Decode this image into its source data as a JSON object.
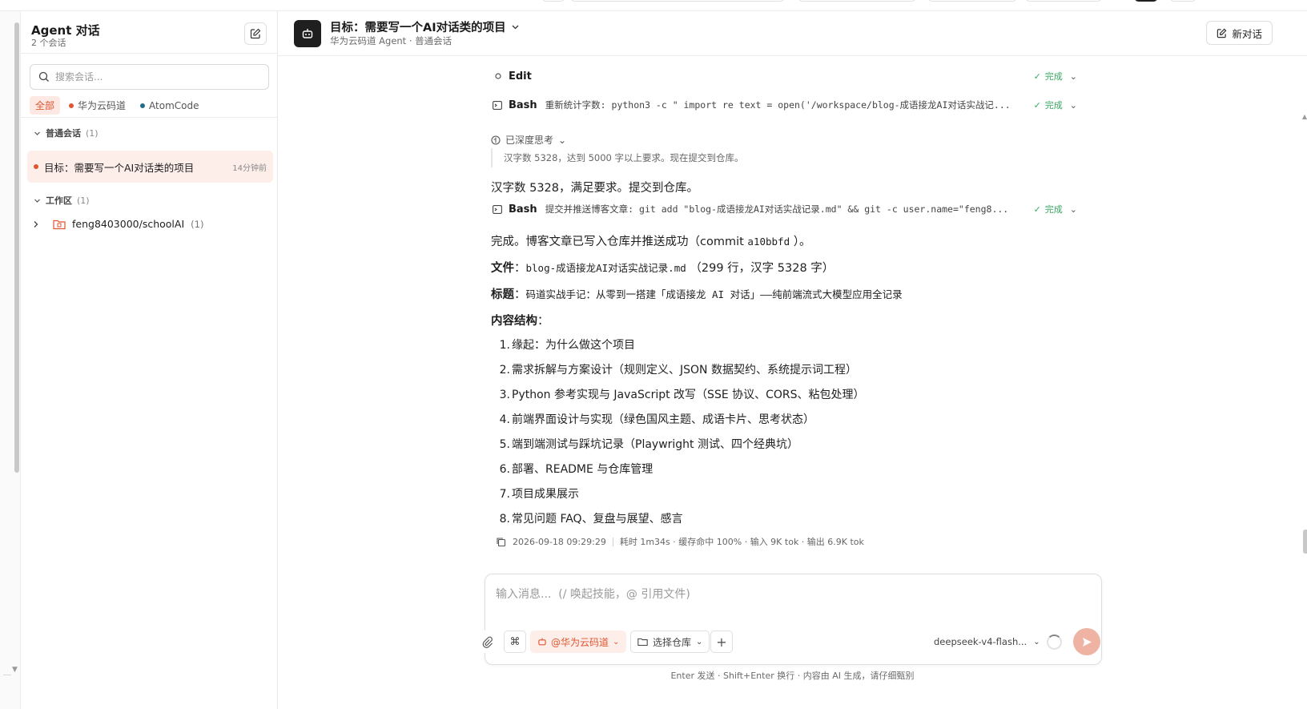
{
  "sidebar": {
    "title": "Agent 对话",
    "subtitle": "2 个会话",
    "search_placeholder": "搜索会话...",
    "filters": [
      {
        "label": "全部",
        "active": true
      },
      {
        "label": "华为云码道",
        "dot_color": "#e0552f"
      },
      {
        "label": "AtomCode",
        "dot_color": "#1f6f8b"
      }
    ],
    "groups": {
      "normal": {
        "label": "普通会话",
        "count": "(1)"
      },
      "workspace": {
        "label": "工作区",
        "count": "(1)"
      }
    },
    "conversation": {
      "label": "目标：需要写一个AI对话类的项目",
      "time": "14分钟前"
    },
    "workspace_item": {
      "label": "feng8403000/schoolAI",
      "count": "(1)"
    }
  },
  "header": {
    "title": "目标：需要写一个AI对话类的项目",
    "subtitle": "华为云码道 Agent · 普通会话",
    "new_chat_label": "新对话"
  },
  "chat": {
    "tools": [
      {
        "name": "Edit",
        "cmd": "",
        "status": "完成"
      },
      {
        "name": "Bash",
        "cmd": "重新统计字数: python3 -c \" import re text = open('/workspace/blog-成语接龙AI对话实战记...",
        "status": "完成"
      },
      {
        "name": "Bash",
        "cmd": "提交并推送博客文章: git add \"blog-成语接龙AI对话实战记录.md\" && git -c user.name=\"feng8...",
        "status": "完成"
      }
    ],
    "thinking_label": "已深度思考",
    "thinking_text": "汉字数 5328，达到 5000 字以上要求。现在提交到仓库。",
    "msg1": "汉字数 5328，满足要求。提交到仓库。",
    "msg2_prefix": "完成。博客文章已写入仓库并推送成功（commit ",
    "msg2_commit": "a10bbfd",
    "msg2_suffix": " ）。",
    "file_label": "文件",
    "file_colon": "：",
    "file_name": "blog-成语接龙AI对话实战记录.md",
    "file_info": "（299 行，汉字 5328 字）",
    "title_label": "标题",
    "title_colon": "：",
    "title_value": "码道实战手记：从零到一搭建「成语接龙 AI 对话」——纯前端流式大模型应用全记录",
    "structure_label": "内容结构",
    "structure_colon": "：",
    "structure": [
      "缘起：为什么做这个项目",
      "需求拆解与方案设计（规则定义、JSON 数据契约、系统提示词工程）",
      "Python 参考实现与 JavaScript 改写（SSE 协议、CORS、粘包处理）",
      "前端界面设计与实现（绿色国风主题、成语卡片、思考状态）",
      "端到端测试与踩坑记录（Playwright 测试、四个经典坑）",
      "部署、README 与仓库管理",
      "项目成果展示",
      "常见问题 FAQ、复盘与展望、感言"
    ],
    "structure_nums": [
      "1.",
      "2.",
      "3.",
      "4.",
      "5.",
      "6.",
      "7.",
      "8."
    ],
    "meta_time": "2026-09-18 09:29:29",
    "meta_stats": "耗时 1m34s · 缓存命中 100% · 输入 9K tok · 输出 6.9K tok"
  },
  "composer": {
    "placeholder": "输入消息...  (/ 唤起技能，@ 引用文件)",
    "agent_label": "@华为云码道",
    "repo_label": "选择仓库",
    "model_label": "deepseek-v4-flash...",
    "hint": "Enter 发送 · Shift+Enter 换行 · 内容由 AI 生成，请仔细甄别"
  },
  "colors": {
    "accent": "#e0552f",
    "success": "#3aa864",
    "send_disabled": "#eeb3a3"
  }
}
